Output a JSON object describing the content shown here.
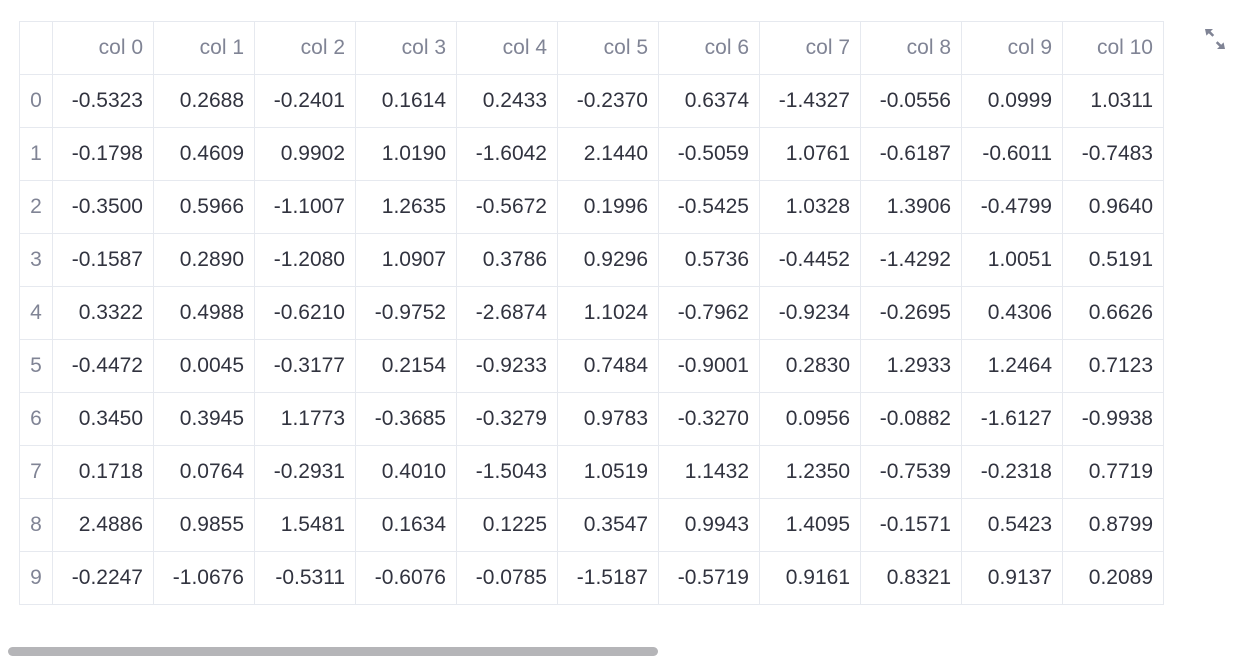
{
  "table": {
    "index_header": "",
    "columns": [
      "col 0",
      "col 1",
      "col 2",
      "col 3",
      "col 4",
      "col 5",
      "col 6",
      "col 7",
      "col 8",
      "col 9",
      "col 10"
    ],
    "rows": [
      {
        "index": "0",
        "cells": [
          "-0.5323",
          "0.2688",
          "-0.2401",
          "0.1614",
          "0.2433",
          "-0.2370",
          "0.6374",
          "-1.4327",
          "-0.0556",
          "0.0999",
          "1.0311"
        ]
      },
      {
        "index": "1",
        "cells": [
          "-0.1798",
          "0.4609",
          "0.9902",
          "1.0190",
          "-1.6042",
          "2.1440",
          "-0.5059",
          "1.0761",
          "-0.6187",
          "-0.6011",
          "-0.7483"
        ]
      },
      {
        "index": "2",
        "cells": [
          "-0.3500",
          "0.5966",
          "-1.1007",
          "1.2635",
          "-0.5672",
          "0.1996",
          "-0.5425",
          "1.0328",
          "1.3906",
          "-0.4799",
          "0.9640"
        ]
      },
      {
        "index": "3",
        "cells": [
          "-0.1587",
          "0.2890",
          "-1.2080",
          "1.0907",
          "0.3786",
          "0.9296",
          "0.5736",
          "-0.4452",
          "-1.4292",
          "1.0051",
          "0.5191"
        ]
      },
      {
        "index": "4",
        "cells": [
          "0.3322",
          "0.4988",
          "-0.6210",
          "-0.9752",
          "-2.6874",
          "1.1024",
          "-0.7962",
          "-0.9234",
          "-0.2695",
          "0.4306",
          "0.6626"
        ]
      },
      {
        "index": "5",
        "cells": [
          "-0.4472",
          "0.0045",
          "-0.3177",
          "0.2154",
          "-0.9233",
          "0.7484",
          "-0.9001",
          "0.2830",
          "1.2933",
          "1.2464",
          "0.7123"
        ]
      },
      {
        "index": "6",
        "cells": [
          "0.3450",
          "0.3945",
          "1.1773",
          "-0.3685",
          "-0.3279",
          "0.9783",
          "-0.3270",
          "0.0956",
          "-0.0882",
          "-1.6127",
          "-0.9938"
        ]
      },
      {
        "index": "7",
        "cells": [
          "0.1718",
          "0.0764",
          "-0.2931",
          "0.4010",
          "-1.5043",
          "1.0519",
          "1.1432",
          "1.2350",
          "-0.7539",
          "-0.2318",
          "0.7719"
        ]
      },
      {
        "index": "8",
        "cells": [
          "2.4886",
          "0.9855",
          "1.5481",
          "0.1634",
          "0.1225",
          "0.3547",
          "0.9943",
          "1.4095",
          "-0.1571",
          "0.5423",
          "0.8799"
        ]
      },
      {
        "index": "9",
        "cells": [
          "-0.2247",
          "-1.0676",
          "-0.5311",
          "-0.6076",
          "-0.0785",
          "-1.5187",
          "-0.5719",
          "0.9161",
          "0.8321",
          "0.9137",
          "0.2089"
        ]
      }
    ]
  },
  "toolbar": {
    "expand_icon": "fullscreen-expand-icon"
  },
  "colors": {
    "text": "#31333f",
    "muted_text": "#808495",
    "grid_line": "#e6e9ef",
    "scrollbar": "#b5b5b8"
  }
}
